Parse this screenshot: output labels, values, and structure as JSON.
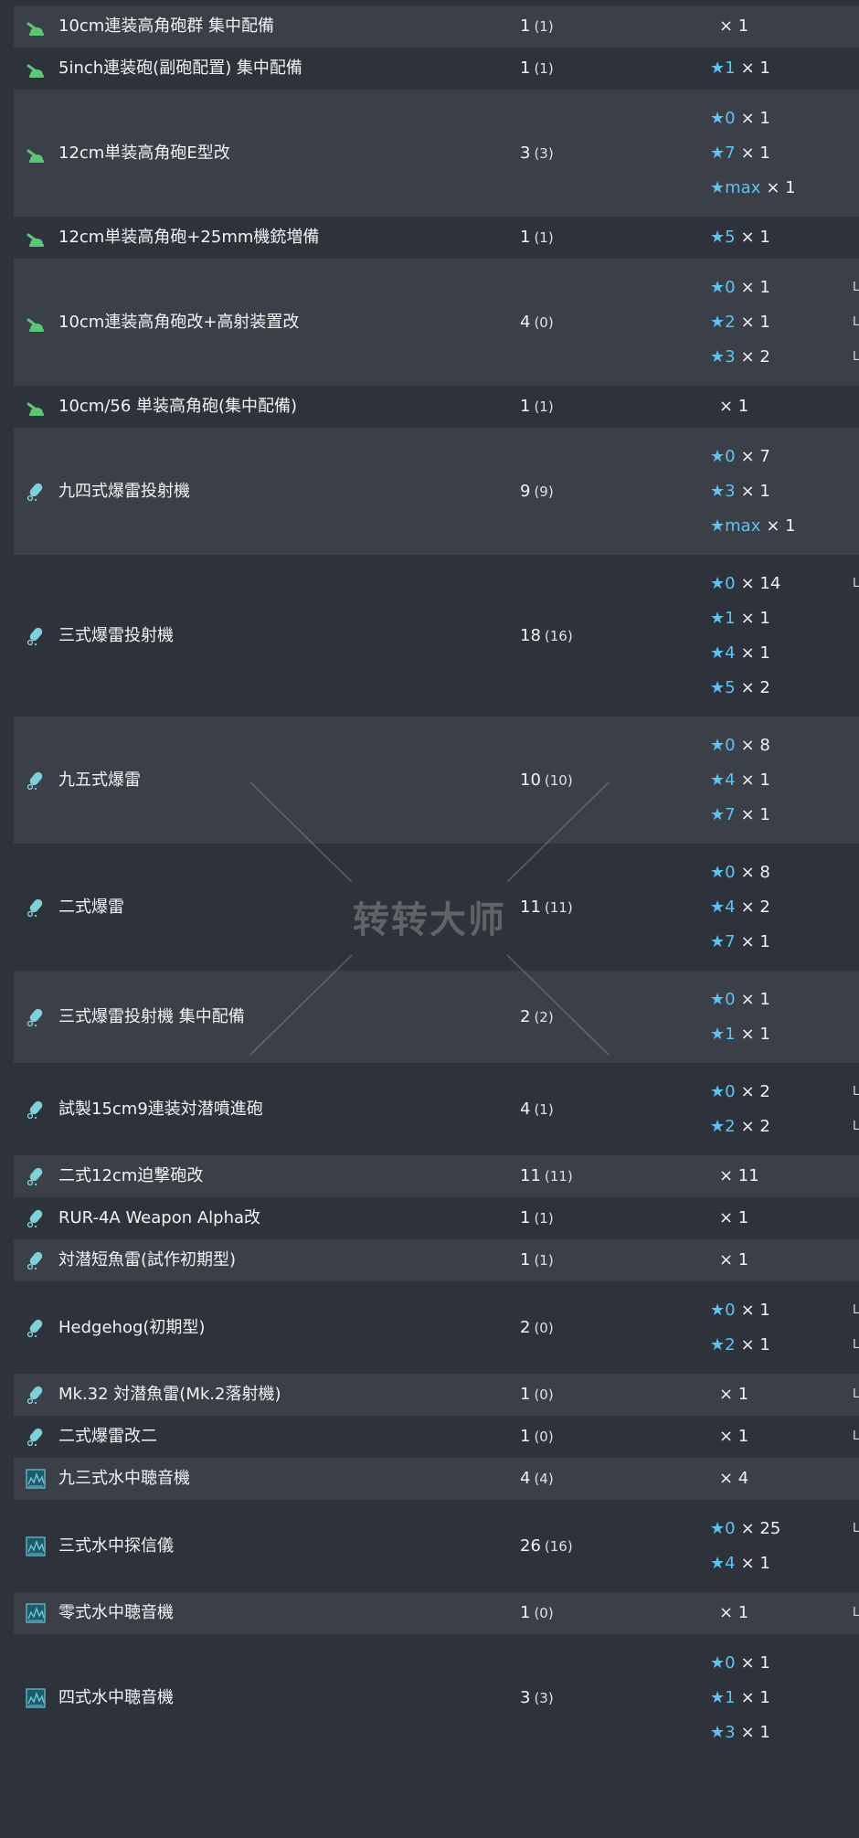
{
  "icon_colors": {
    "aa_gun": "#5cc779",
    "depth_charge": "#7fd1d9",
    "sonar": "#6cc6d6"
  },
  "star_symbol": "★",
  "rows": [
    {
      "icon": "aa-gun",
      "name": "10cm連装高角砲群 集中配備",
      "count": "1",
      "count_sub": "(1)",
      "stars": [
        {
          "lvl": "",
          "qty": "× 1"
        }
      ],
      "lmarks": []
    },
    {
      "icon": "aa-gun",
      "name": "5inch連装砲(副砲配置) 集中配備",
      "count": "1",
      "count_sub": "(1)",
      "stars": [
        {
          "lvl": "1",
          "qty": "× 1"
        }
      ],
      "lmarks": []
    },
    {
      "icon": "aa-gun",
      "name": "12cm単装高角砲E型改",
      "count": "3",
      "count_sub": "(3)",
      "stars": [
        {
          "lvl": "0",
          "qty": "× 1"
        },
        {
          "lvl": "7",
          "qty": "× 1"
        },
        {
          "lvl": "max",
          "qty": "× 1"
        }
      ],
      "lmarks": []
    },
    {
      "icon": "aa-gun",
      "name": "12cm単装高角砲+25mm機銃増備",
      "count": "1",
      "count_sub": "(1)",
      "stars": [
        {
          "lvl": "5",
          "qty": "× 1"
        }
      ],
      "lmarks": []
    },
    {
      "icon": "aa-gun",
      "name": "10cm連装高角砲改+高射装置改",
      "count": "4",
      "count_sub": "(0)",
      "stars": [
        {
          "lvl": "0",
          "qty": "× 1"
        },
        {
          "lvl": "2",
          "qty": "× 1"
        },
        {
          "lvl": "3",
          "qty": "× 2"
        }
      ],
      "lmarks": [
        "L",
        "L",
        "L"
      ]
    },
    {
      "icon": "aa-gun",
      "name": "10cm/56 単装高角砲(集中配備)",
      "count": "1",
      "count_sub": "(1)",
      "stars": [
        {
          "lvl": "",
          "qty": "× 1"
        }
      ],
      "lmarks": []
    },
    {
      "icon": "depth-charge",
      "name": "九四式爆雷投射機",
      "count": "9",
      "count_sub": "(9)",
      "stars": [
        {
          "lvl": "0",
          "qty": "× 7"
        },
        {
          "lvl": "3",
          "qty": "× 1"
        },
        {
          "lvl": "max",
          "qty": "× 1"
        }
      ],
      "lmarks": []
    },
    {
      "icon": "depth-charge",
      "name": "三式爆雷投射機",
      "count": "18",
      "count_sub": "(16)",
      "stars": [
        {
          "lvl": "0",
          "qty": "× 14"
        },
        {
          "lvl": "1",
          "qty": "× 1"
        },
        {
          "lvl": "4",
          "qty": "× 1"
        },
        {
          "lvl": "5",
          "qty": "× 2"
        }
      ],
      "lmarks": [
        "L",
        "",
        "",
        ""
      ]
    },
    {
      "icon": "depth-charge",
      "name": "九五式爆雷",
      "count": "10",
      "count_sub": "(10)",
      "stars": [
        {
          "lvl": "0",
          "qty": "× 8"
        },
        {
          "lvl": "4",
          "qty": "× 1"
        },
        {
          "lvl": "7",
          "qty": "× 1"
        }
      ],
      "lmarks": []
    },
    {
      "icon": "depth-charge",
      "name": "二式爆雷",
      "count": "11",
      "count_sub": "(11)",
      "stars": [
        {
          "lvl": "0",
          "qty": "× 8"
        },
        {
          "lvl": "4",
          "qty": "× 2"
        },
        {
          "lvl": "7",
          "qty": "× 1"
        }
      ],
      "lmarks": []
    },
    {
      "icon": "depth-charge",
      "name": "三式爆雷投射機 集中配備",
      "count": "2",
      "count_sub": "(2)",
      "stars": [
        {
          "lvl": "0",
          "qty": "× 1"
        },
        {
          "lvl": "1",
          "qty": "× 1"
        }
      ],
      "lmarks": []
    },
    {
      "icon": "depth-charge",
      "name": "試製15cm9連装対潜噴進砲",
      "count": "4",
      "count_sub": "(1)",
      "stars": [
        {
          "lvl": "0",
          "qty": "× 2"
        },
        {
          "lvl": "2",
          "qty": "× 2"
        }
      ],
      "lmarks": [
        "L",
        "L"
      ]
    },
    {
      "icon": "depth-charge",
      "name": "二式12cm迫撃砲改",
      "count": "11",
      "count_sub": "(11)",
      "stars": [
        {
          "lvl": "",
          "qty": "× 11"
        }
      ],
      "lmarks": []
    },
    {
      "icon": "depth-charge",
      "name": "RUR-4A Weapon Alpha改",
      "count": "1",
      "count_sub": "(1)",
      "stars": [
        {
          "lvl": "",
          "qty": "× 1"
        }
      ],
      "lmarks": []
    },
    {
      "icon": "depth-charge",
      "name": "対潜短魚雷(試作初期型)",
      "count": "1",
      "count_sub": "(1)",
      "stars": [
        {
          "lvl": "",
          "qty": "× 1"
        }
      ],
      "lmarks": []
    },
    {
      "icon": "depth-charge",
      "name": "Hedgehog(初期型)",
      "count": "2",
      "count_sub": "(0)",
      "stars": [
        {
          "lvl": "0",
          "qty": "× 1"
        },
        {
          "lvl": "2",
          "qty": "× 1"
        }
      ],
      "lmarks": [
        "L",
        "L"
      ]
    },
    {
      "icon": "depth-charge",
      "name": "Mk.32 対潜魚雷(Mk.2落射機)",
      "count": "1",
      "count_sub": "(0)",
      "stars": [
        {
          "lvl": "",
          "qty": "× 1"
        }
      ],
      "lmarks": [
        "L"
      ]
    },
    {
      "icon": "depth-charge",
      "name": "二式爆雷改二",
      "count": "1",
      "count_sub": "(0)",
      "stars": [
        {
          "lvl": "",
          "qty": "× 1"
        }
      ],
      "lmarks": [
        "L"
      ]
    },
    {
      "icon": "sonar",
      "name": "九三式水中聴音機",
      "count": "4",
      "count_sub": "(4)",
      "stars": [
        {
          "lvl": "",
          "qty": "× 4"
        }
      ],
      "lmarks": []
    },
    {
      "icon": "sonar",
      "name": "三式水中探信儀",
      "count": "26",
      "count_sub": "(16)",
      "stars": [
        {
          "lvl": "0",
          "qty": "× 25"
        },
        {
          "lvl": "4",
          "qty": "× 1"
        }
      ],
      "lmarks": [
        "L",
        ""
      ]
    },
    {
      "icon": "sonar",
      "name": "零式水中聴音機",
      "count": "1",
      "count_sub": "(0)",
      "stars": [
        {
          "lvl": "",
          "qty": "× 1"
        }
      ],
      "lmarks": [
        "L"
      ]
    },
    {
      "icon": "sonar",
      "name": "四式水中聴音機",
      "count": "3",
      "count_sub": "(3)",
      "stars": [
        {
          "lvl": "0",
          "qty": "× 1"
        },
        {
          "lvl": "1",
          "qty": "× 1"
        },
        {
          "lvl": "3",
          "qty": "× 1"
        }
      ],
      "lmarks": []
    }
  ],
  "watermark": {
    "text": "转转大师"
  }
}
